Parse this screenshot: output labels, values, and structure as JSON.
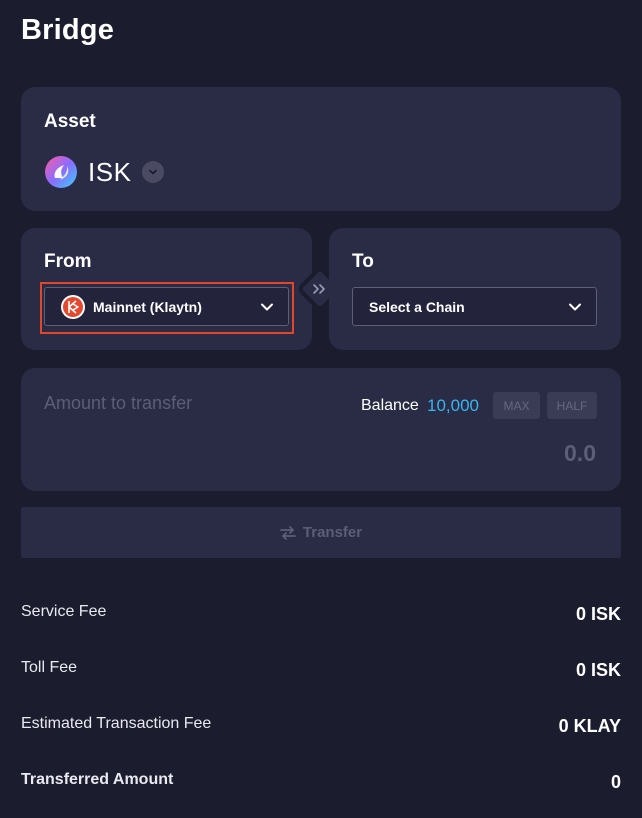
{
  "page": {
    "title": "Bridge"
  },
  "asset": {
    "label": "Asset",
    "symbol": "ISK",
    "icon": "isk-token-logo",
    "dropdown_icon": "chevron-down-icon"
  },
  "from": {
    "label": "From",
    "selected_chain": "Mainnet (Klaytn)",
    "chain_icon": "klaytn-logo",
    "dropdown_icon": "chevron-down-icon"
  },
  "swap": {
    "icon": "double-chevron-right-icon"
  },
  "to": {
    "label": "To",
    "selected_chain": "Select a Chain",
    "dropdown_icon": "chevron-down-icon"
  },
  "amount": {
    "placeholder": "Amount to transfer",
    "balance_label": "Balance",
    "balance_value": "10,000",
    "max_label": "MAX",
    "half_label": "HALF",
    "value": "0.0"
  },
  "transfer_button": {
    "label": "Transfer",
    "icon": "swap-arrows-icon",
    "disabled": true
  },
  "fees": [
    {
      "label": "Service Fee",
      "value": "0 ISK"
    },
    {
      "label": "Toll Fee",
      "value": "0 ISK"
    },
    {
      "label": "Estimated Transaction Fee",
      "value": "0 KLAY"
    },
    {
      "label": "Transferred Amount",
      "value": "0"
    }
  ],
  "colors": {
    "background": "#1b1c2d",
    "card": "#2a2b45",
    "accent_balance": "#38b5ef",
    "highlight_border": "#e0472c",
    "muted_text": "#5c5d77"
  }
}
